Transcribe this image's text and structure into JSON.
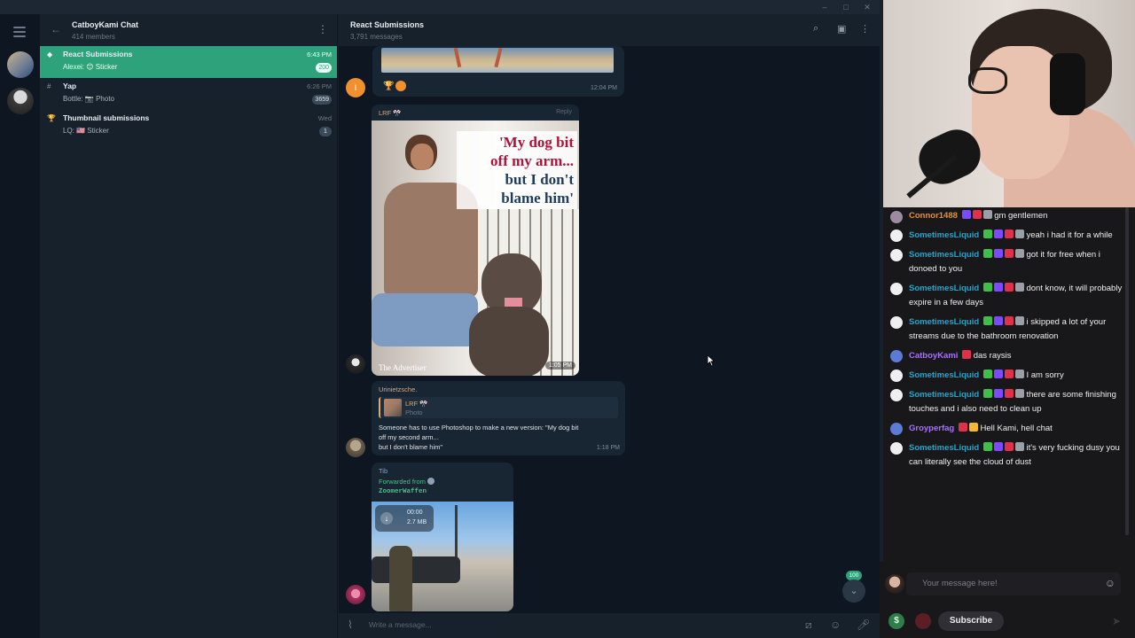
{
  "telegram": {
    "group": {
      "title": "CatboyKami Chat",
      "subtitle": "414 members"
    },
    "topics": [
      {
        "name": "React Submissions",
        "last": "Alexei: 😊 Sticker",
        "time": "6:43 PM",
        "badge": "200",
        "active": true,
        "icon": "diamond-icon"
      },
      {
        "name": "Yap",
        "last": "Bottle: 📷 Photo",
        "time": "6:26 PM",
        "badge": "3659",
        "active": false,
        "icon": "hash-icon"
      },
      {
        "name": "Thumbnail submissions",
        "last": "LQ: 🇺🇸 Sticker",
        "time": "Wed",
        "badge": "1",
        "active": false,
        "icon": "trophy-icon"
      }
    ],
    "conversation": {
      "title": "React Submissions",
      "subtitle": "3,791 messages",
      "messages": {
        "m1": {
          "time": "12:04 PM",
          "avatar_letter": "I"
        },
        "m2": {
          "sender": "LRF 🎌",
          "reply_label": "Reply",
          "headline_1": "'My dog bit",
          "headline_2": "off my arm...",
          "headline_3": "but I don't",
          "headline_4": "blame him'",
          "watermark": "The Advertiser",
          "time": "1:05 PM"
        },
        "m3": {
          "sender": "Urinietzsche.",
          "quote_sender": "LRF 🎌",
          "quote_type": "Photo",
          "text_1": "Someone has to use Photoshop to make a new version: \"My dog bit",
          "text_2": "off my second arm...",
          "text_3": "but I don't blame him\"",
          "time": "1:18 PM"
        },
        "m4": {
          "sender": "Tib",
          "forwarded_label": "Forwarded from",
          "forwarded_name": "ZoomerWaffen",
          "video_duration": "00:00",
          "video_size": "2.7 MB"
        }
      },
      "scroll_badge": "100",
      "composer_placeholder": "Write a message..."
    },
    "colors": {
      "accent": "#2ea27a",
      "bg": "#0e1621",
      "panel": "#17212b",
      "bubble": "#182533"
    }
  },
  "twitch": {
    "messages": [
      {
        "user": "Connor1488",
        "color": "#e0903a",
        "text": "gm gentlemen"
      },
      {
        "user": "SometimesLiquid",
        "color": "#2aa3c8",
        "text": "yeah i had it for a while"
      },
      {
        "user": "SometimesLiquid",
        "color": "#2aa3c8",
        "text": "got it for free when i donoed to you"
      },
      {
        "user": "SometimesLiquid",
        "color": "#2aa3c8",
        "text": "dont know, it will probably expire in a few days"
      },
      {
        "user": "SometimesLiquid",
        "color": "#2aa3c8",
        "text": "i skipped a lot of your streams due to the bathroom renovation"
      },
      {
        "user": "CatboyKami",
        "color": "#a970ff",
        "text": "das raysis"
      },
      {
        "user": "SometimesLiquid",
        "color": "#2aa3c8",
        "text": "I am sorry"
      },
      {
        "user": "SometimesLiquid",
        "color": "#2aa3c8",
        "text": "there are some finishing touches and i also need to clean up"
      },
      {
        "user": "Groyperfag",
        "color": "#a970ff",
        "text": "Hell Kami, hell chat"
      },
      {
        "user": "SometimesLiquid",
        "color": "#2aa3c8",
        "text": "it's very fucking dusy you can literally see the cloud of dust"
      }
    ],
    "input_placeholder": "Your message here!",
    "subscribe_label": "Subscribe"
  }
}
